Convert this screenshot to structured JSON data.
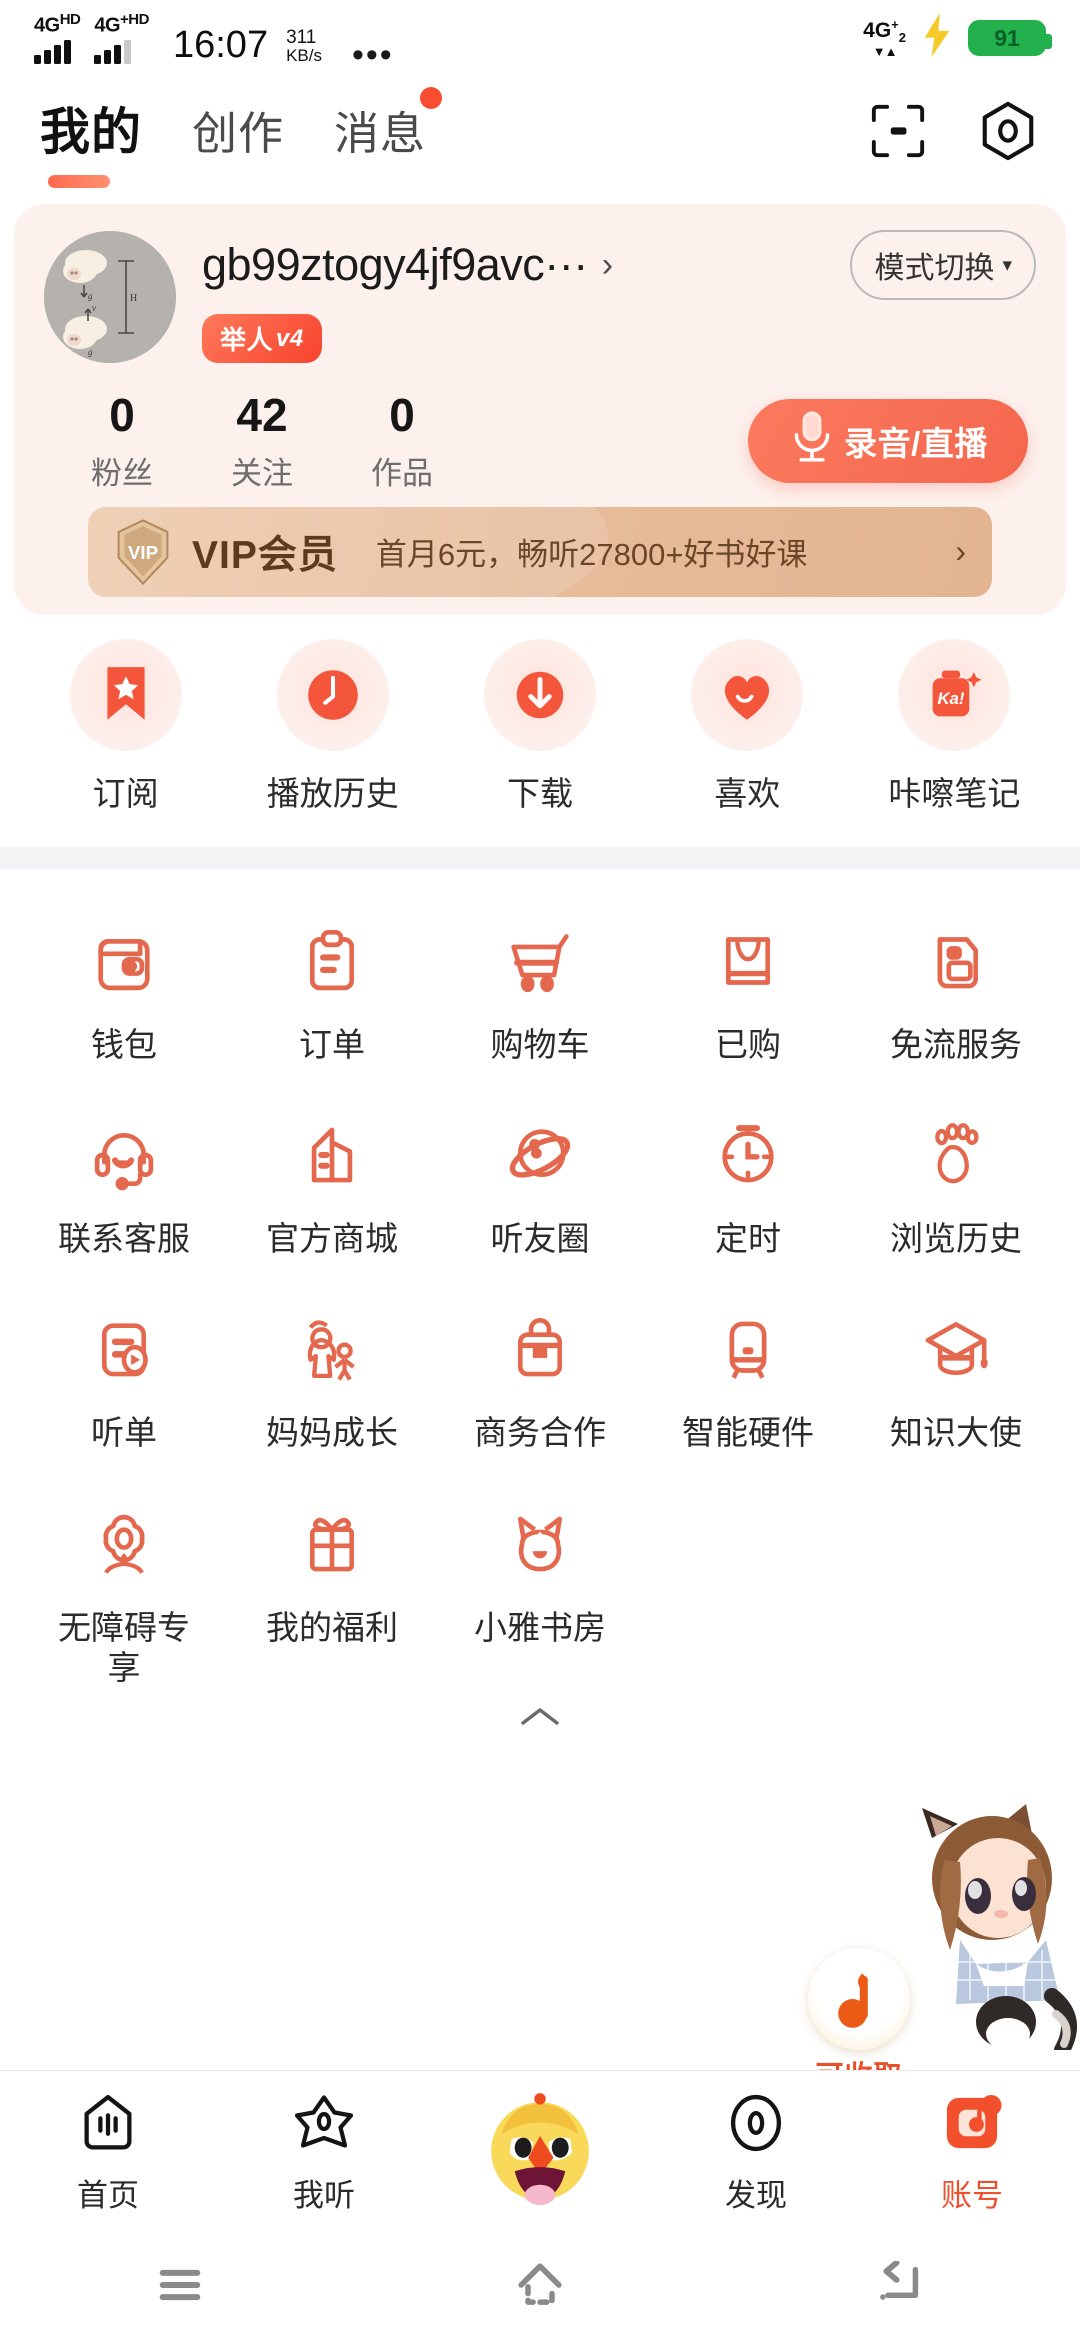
{
  "status_bar": {
    "carrier1": {
      "label": "4G",
      "sup": "HD"
    },
    "carrier2": {
      "label": "4G",
      "sup": "+HD"
    },
    "time": "16:07",
    "net_speed_value": "311",
    "net_speed_unit": "KB/s",
    "overflow": "•••",
    "right_network": {
      "label": "4G",
      "sup": "+",
      "sub": "2",
      "arrows": "▼▲"
    },
    "charging_icon": "bolt-icon",
    "battery_percent": "91"
  },
  "header": {
    "tabs": [
      {
        "label": "我的",
        "active": true,
        "badge": false
      },
      {
        "label": "创作",
        "active": false,
        "badge": false
      },
      {
        "label": "消息",
        "active": false,
        "badge": true
      }
    ],
    "actions": [
      {
        "name": "scan-icon",
        "label": "扫一扫"
      },
      {
        "name": "settings-icon",
        "label": "设置"
      }
    ]
  },
  "profile": {
    "avatar_name": "user-avatar",
    "username": "gb99ztogy4jf9avc···",
    "chevron": "›",
    "mode_switch_label": "模式切换",
    "mode_switch_caret": "▾",
    "level_badge": "举人",
    "level_badge_version": "v4",
    "stats": [
      {
        "value": "0",
        "label": "粉丝"
      },
      {
        "value": "42",
        "label": "关注"
      },
      {
        "value": "0",
        "label": "作品"
      }
    ],
    "record_button": "录音/直播"
  },
  "vip_banner": {
    "shield_text": "VIP",
    "title": "VIP会员",
    "subtitle": "首月6元，畅听27800+好书好课",
    "arrow": "›"
  },
  "quick_actions": [
    {
      "label": "订阅",
      "icon": "bookmark-star-icon"
    },
    {
      "label": "播放历史",
      "icon": "clock-history-icon"
    },
    {
      "label": "下载",
      "icon": "download-cloud-icon"
    },
    {
      "label": "喜欢",
      "icon": "heart-icon"
    },
    {
      "label": "咔嚓笔记",
      "icon": "ka-note-icon"
    }
  ],
  "service_grid": [
    {
      "label": "钱包",
      "icon": "wallet-icon"
    },
    {
      "label": "订单",
      "icon": "clipboard-order-icon"
    },
    {
      "label": "购物车",
      "icon": "shopping-cart-icon"
    },
    {
      "label": "已购",
      "icon": "shopping-bag-icon"
    },
    {
      "label": "免流服务",
      "icon": "data-free-icon"
    },
    {
      "label": "联系客服",
      "icon": "headset-support-icon"
    },
    {
      "label": "官方商城",
      "icon": "store-building-icon"
    },
    {
      "label": "听友圈",
      "icon": "planet-community-icon"
    },
    {
      "label": "定时",
      "icon": "timer-icon"
    },
    {
      "label": "浏览历史",
      "icon": "footprint-icon"
    },
    {
      "label": "听单",
      "icon": "playlist-icon"
    },
    {
      "label": "妈妈成长",
      "icon": "mother-child-icon"
    },
    {
      "label": "商务合作",
      "icon": "briefcase-icon"
    },
    {
      "label": "智能硬件",
      "icon": "smart-speaker-icon"
    },
    {
      "label": "知识大使",
      "icon": "graduation-cap-icon"
    },
    {
      "label": "无障碍专享",
      "icon": "flower-accessibility-icon"
    },
    {
      "label": "我的福利",
      "icon": "gift-icon"
    },
    {
      "label": "小雅书房",
      "icon": "cat-bookroom-icon"
    }
  ],
  "collapse_chevron": "⌃",
  "floating_coin": {
    "icon": "music-note-coin-icon",
    "label": "可收取"
  },
  "mascot": {
    "name": "anime-girl-mascot"
  },
  "bottom_nav": [
    {
      "label": "首页",
      "icon": "home-icon",
      "active": false
    },
    {
      "label": "我听",
      "icon": "star-listen-icon",
      "active": false
    },
    {
      "label": "",
      "icon": "duck-face-icon",
      "active": false
    },
    {
      "label": "发现",
      "icon": "discover-icon",
      "active": false
    },
    {
      "label": "账号",
      "icon": "account-icon",
      "active": true
    }
  ],
  "system_nav": [
    {
      "name": "recents-button",
      "glyph": "menu"
    },
    {
      "name": "home-button",
      "glyph": "home"
    },
    {
      "name": "back-button",
      "glyph": "back"
    }
  ],
  "colors": {
    "accent": "#f1502f",
    "accent_light": "#fb7a5f",
    "card_pink": "#fdf1ee",
    "vip_gold": "#e8bd9c",
    "badge_red": "#fa4d30",
    "battery_green": "#22b14c"
  }
}
